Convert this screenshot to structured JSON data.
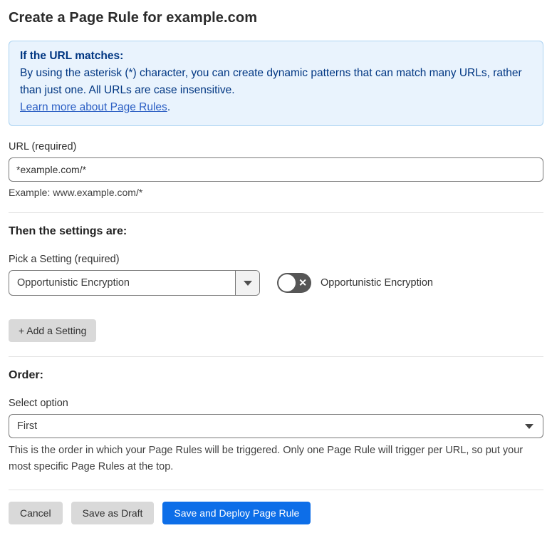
{
  "page": {
    "title": "Create a Page Rule for example.com"
  },
  "info_box": {
    "heading": "If the URL matches:",
    "body": "By using the asterisk (*) character, you can create dynamic patterns that can match many URLs, rather than just one. All URLs are case insensitive.",
    "link_label": "Learn more about Page Rules",
    "link_suffix": "."
  },
  "url_field": {
    "label": "URL (required)",
    "value": "*example.com/*",
    "example": "Example: www.example.com/*"
  },
  "settings_section": {
    "heading": "Then the settings are:",
    "picker_label": "Pick a Setting (required)",
    "picker_value": "Opportunistic Encryption",
    "toggle_state": "off",
    "toggle_glyph": "✕",
    "toggle_label": "Opportunistic Encryption",
    "add_button_label": "+ Add a Setting"
  },
  "order_section": {
    "heading": "Order:",
    "select_label": "Select option",
    "select_value": "First",
    "help": "This is the order in which your Page Rules will be triggered. Only one Page Rule will trigger per URL, so put your most specific Page Rules at the top."
  },
  "actions": {
    "cancel_label": "Cancel",
    "save_draft_label": "Save as Draft",
    "save_deploy_label": "Save and Deploy Page Rule"
  },
  "colors": {
    "primary_button": "#0d6ee8",
    "secondary_button": "#d9d9d9",
    "info_background": "#e9f3fd",
    "info_border": "#abd3f2",
    "info_text": "#003682",
    "link": "#2c5fc4",
    "toggle_off": "#565656",
    "divider": "#e2e2e2"
  }
}
